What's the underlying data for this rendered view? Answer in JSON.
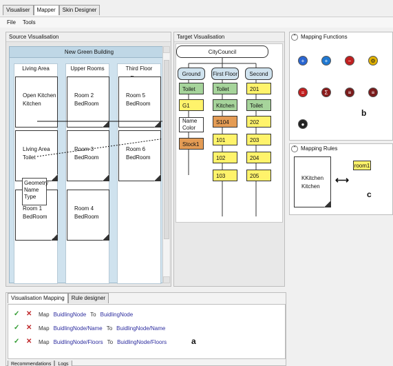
{
  "top_tabs": [
    "Visualiser",
    "Mapper",
    "Skin Designer"
  ],
  "menubar": [
    "File",
    "Tools"
  ],
  "source": {
    "panel_title": "Source Visualisation",
    "building_title": "New Green Building",
    "columns": [
      {
        "title": "Living Area"
      },
      {
        "title": "Upper Rooms"
      },
      {
        "title": "Third Floor Rooms"
      }
    ],
    "rooms": {
      "open_kitchen": {
        "t1": "Open Kitchen",
        "t2": "Kitchen"
      },
      "living_area": {
        "t1": "Living Area",
        "t2": "Toilet"
      },
      "room1": {
        "t1": "Room 1",
        "t2": "BedRoom"
      },
      "room2": {
        "t1": "Room 2",
        "t2": "BedRoom"
      },
      "room3": {
        "t1": "Room 3",
        "t2": "BedRoom"
      },
      "room4": {
        "t1": "Room 4",
        "t2": "BedRoom"
      },
      "room5": {
        "t1": "Room 5",
        "t2": "BedRoom"
      },
      "room6": {
        "t1": "Room 6",
        "t2": "BedRoom"
      }
    },
    "popup_lines": [
      "Geometry",
      "Name",
      "Type"
    ]
  },
  "target": {
    "panel_title": "Target Visualisation",
    "root": "CityCouncil",
    "floors": [
      {
        "head": "Ground",
        "nodes": [
          "Toilet",
          "G1",
          "Name\nColor",
          "Stock1"
        ],
        "colors": [
          "green",
          "yellow",
          "none",
          "orange"
        ]
      },
      {
        "head": "First Floor",
        "nodes": [
          "Toilet",
          "Kitchen",
          "S104",
          "101",
          "102",
          "103"
        ],
        "colors": [
          "green",
          "green",
          "orange",
          "yellow",
          "yellow",
          "yellow"
        ]
      },
      {
        "head": "Second Floor",
        "nodes": [
          "201",
          "Toilet",
          "202",
          "203",
          "204",
          "205"
        ],
        "colors": [
          "yellow",
          "green",
          "yellow",
          "yellow",
          "yellow",
          "yellow"
        ]
      }
    ],
    "badge_name": "Name",
    "badge_color": "Color"
  },
  "mapping_functions": {
    "title": "Mapping Functions",
    "label": "b",
    "icons": [
      {
        "name": "plus-circle-icon",
        "symbol": "+",
        "color": "#2a66d1"
      },
      {
        "name": "add-node-icon",
        "symbol": "+",
        "color": "#1f78d1"
      },
      {
        "name": "remove-node-icon",
        "symbol": "−",
        "color": "#c11f1f"
      },
      {
        "name": "settings-gear-icon",
        "symbol": "⚙",
        "color": "#e0b100"
      },
      {
        "name": "equals-circle-icon",
        "symbol": "=",
        "color": "#c11f1f"
      },
      {
        "name": "sum-icon",
        "symbol": "Σ",
        "color": "#8b1b1b"
      },
      {
        "name": "doc-icon",
        "symbol": "≡",
        "color": "#7a1b1b"
      },
      {
        "name": "list-icon",
        "symbol": "≡",
        "color": "#7a1b1b"
      },
      {
        "name": "target-icon",
        "symbol": "●",
        "color": "#222"
      }
    ]
  },
  "mapping_rules": {
    "title": "Mapping Rules",
    "label": "c",
    "card_t1": "KKitchen",
    "card_t2": "Kitchen",
    "target_node": "room1"
  },
  "bottom": {
    "tabs": [
      "Visualisation Mapping",
      "Rule designer"
    ],
    "rows": [
      {
        "kw": "Map",
        "from": "BuidlingNode",
        "to_kw": "To",
        "to": "BuidlingNode"
      },
      {
        "kw": "Map",
        "from": "BuidlingNode/Name",
        "to_kw": "To",
        "to": "BuidlingNode/Name"
      },
      {
        "kw": "Map",
        "from": "BuidlingNode/Floors",
        "to_kw": "To",
        "to": "BuidlingNode/Floors"
      }
    ],
    "label": "a",
    "bottom_tabs": [
      "Recommendations",
      "Logs"
    ]
  }
}
